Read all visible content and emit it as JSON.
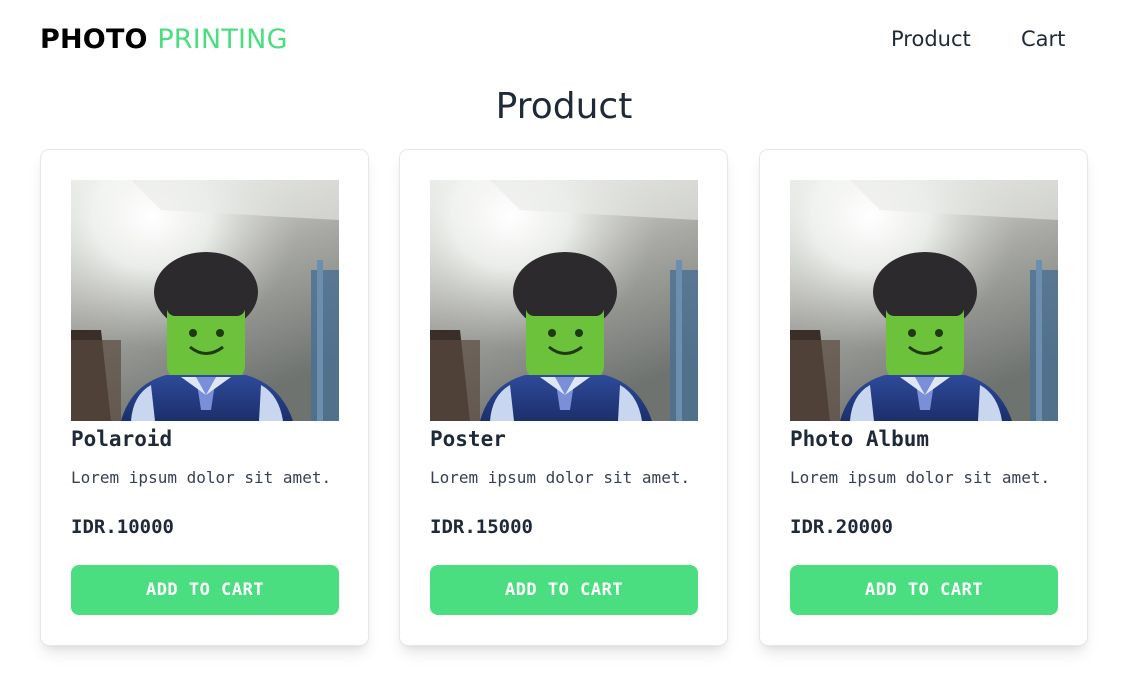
{
  "colors": {
    "accent": "#4ade80"
  },
  "nav": {
    "brand_part1": "PHOTO",
    "brand_part2": "PRINTING",
    "links": [
      {
        "label": "Product"
      },
      {
        "label": "Cart"
      }
    ]
  },
  "page": {
    "title": "Product"
  },
  "products": [
    {
      "name": "Polaroid",
      "description": "Lorem ipsum dolor sit amet.",
      "price": "IDR.10000",
      "button_label": "ADD TO CART",
      "image": "lego-figure-photo"
    },
    {
      "name": "Poster",
      "description": "Lorem ipsum dolor sit amet.",
      "price": "IDR.15000",
      "button_label": "ADD TO CART",
      "image": "lego-figure-photo"
    },
    {
      "name": "Photo Album",
      "description": "Lorem ipsum dolor sit amet.",
      "price": "IDR.20000",
      "button_label": "ADD TO CART",
      "image": "lego-figure-photo"
    }
  ]
}
